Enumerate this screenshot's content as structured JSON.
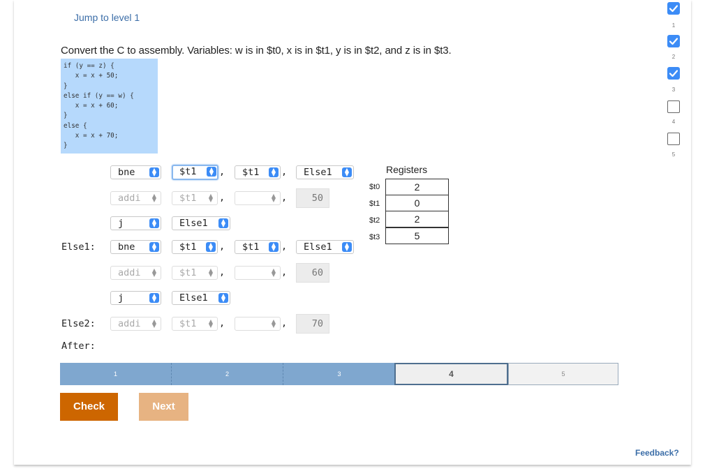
{
  "jump_link": "Jump to level 1",
  "prompt": "Convert the C to assembly. Variables: w is in $t0, x is in $t1, y is in $t2, and z is in $t3.",
  "code": "if (y == z) {\n   x = x + 50;\n}\nelse if (y == w) {\n   x = x + 60;\n}\nelse {\n   x = x + 70;\n}",
  "rows": [
    {
      "label": "",
      "op": "bne",
      "a": "$t1",
      "b": "$t1",
      "c": "Else1"
    },
    {
      "label": "",
      "op": "addi",
      "a": "$t1",
      "b": "",
      "imm": "50"
    },
    {
      "label": "",
      "op": "j",
      "target": "Else1"
    },
    {
      "label": "Else1:",
      "op": "bne",
      "a": "$t1",
      "b": "$t1",
      "c": "Else1"
    },
    {
      "label": "",
      "op": "addi",
      "a": "$t1",
      "b": "",
      "imm": "60"
    },
    {
      "label": "",
      "op": "j",
      "target": "Else1"
    },
    {
      "label": "Else2:",
      "op": "addi",
      "a": "$t1",
      "b": "",
      "imm": "70"
    }
  ],
  "after_label": "After:",
  "registers": {
    "title": "Registers",
    "items": [
      {
        "name": "$t0",
        "value": "2"
      },
      {
        "name": "$t1",
        "value": "0"
      },
      {
        "name": "$t2",
        "value": "2"
      },
      {
        "name": "$t3",
        "value": "5"
      }
    ]
  },
  "progress": {
    "segments": [
      "1",
      "2",
      "3",
      "4",
      "5"
    ],
    "current": 4
  },
  "buttons": {
    "check": "Check",
    "next": "Next"
  },
  "feedback": "Feedback?",
  "levels": [
    {
      "num": "1",
      "status": "done"
    },
    {
      "num": "2",
      "status": "done"
    },
    {
      "num": "3",
      "status": "done"
    },
    {
      "num": "4",
      "status": "todo"
    },
    {
      "num": "5",
      "status": "todo"
    }
  ],
  "colors": {
    "accent": "#3c8cf6",
    "check": "#cd6600",
    "next": "#e7b382",
    "code_bg": "#b6d9fc",
    "progress_done": "#7fa7cf"
  }
}
